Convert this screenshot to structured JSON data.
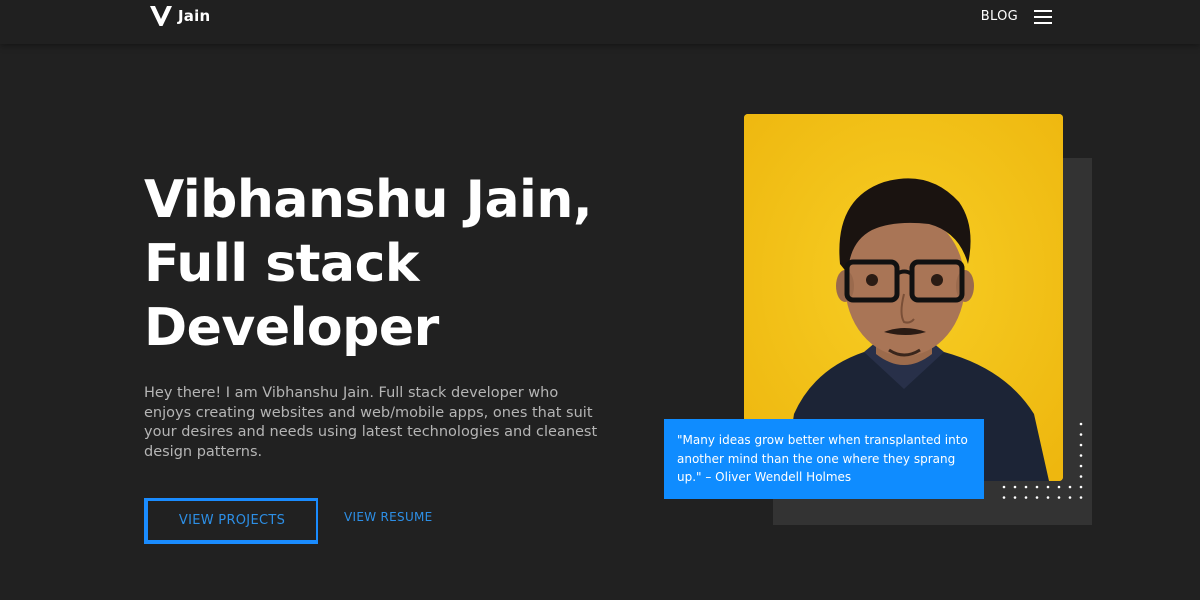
{
  "nav": {
    "logo_text": "Jain",
    "blog_label": "BLOG"
  },
  "hero": {
    "title_line1": "Vibhanshu Jain,",
    "title_line2": "Full stack",
    "title_line3": "Developer",
    "description": "Hey there! I am Vibhanshu Jain. Full stack developer who enjoys creating websites and web/mobile apps, ones that suit your desires and needs using latest technologies and cleanest design patterns.",
    "primary_button": "VIEW PROJECTS",
    "secondary_button": "VIEW RESUME"
  },
  "quote": {
    "text": "\"Many ideas grow better when transplanted into another mind than the one where they sprang up.\" – Oliver Wendell Holmes"
  },
  "icons": {
    "logo": "v-logo-icon",
    "menu": "hamburger-menu-icon"
  },
  "colors": {
    "background": "#212121",
    "accent": "#0f8cff",
    "photo_background": "#f2c318",
    "text_muted": "#b5b5b5"
  }
}
